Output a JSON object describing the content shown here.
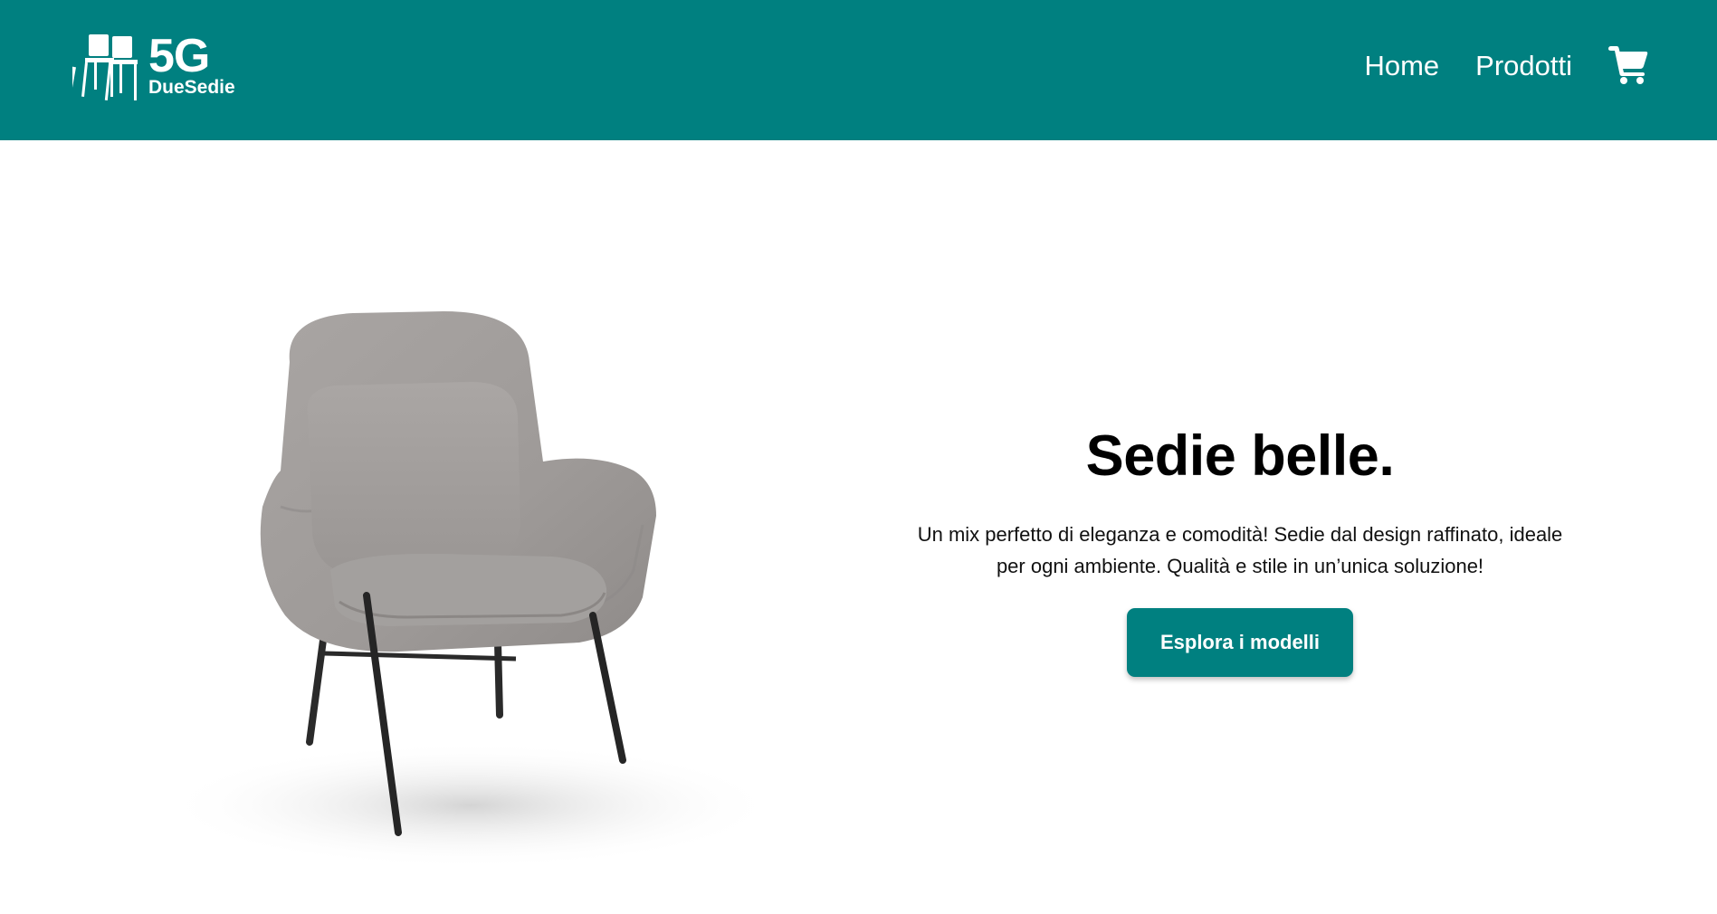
{
  "brand": {
    "logo_number": "5G",
    "logo_name": "DueSedie"
  },
  "nav": {
    "items": [
      {
        "label": "Home"
      },
      {
        "label": "Prodotti"
      }
    ],
    "cart_icon": "shopping-cart-icon"
  },
  "hero": {
    "title": "Sedie belle.",
    "description": "Un mix perfetto di eleganza e comodità! Sedie dal design raffinato, ideale per ogni ambiente. Qualità e stile in un’unica soluzione!",
    "cta_label": "Esplora i modelli",
    "image": "armchair-image"
  },
  "colors": {
    "brand": "#008080",
    "background": "#ffffff",
    "text": "#000000"
  }
}
